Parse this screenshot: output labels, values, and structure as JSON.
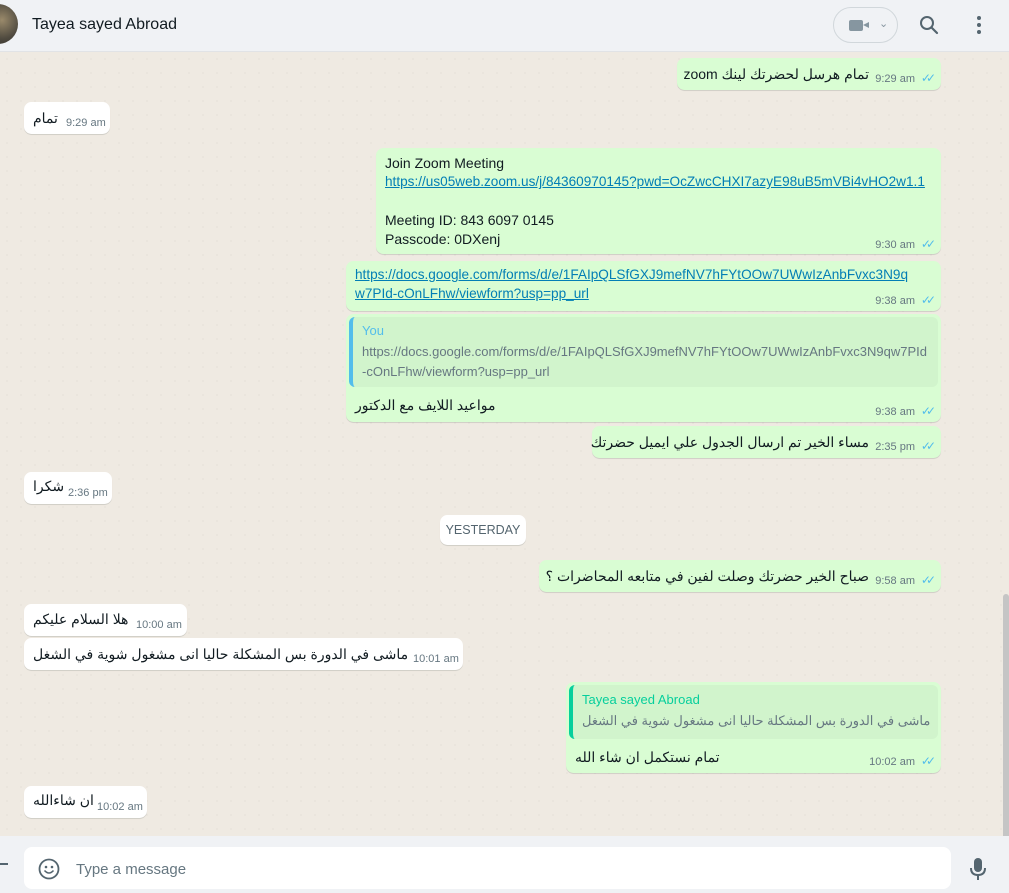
{
  "header": {
    "contact_name": "Tayea sayed Abroad"
  },
  "input": {
    "placeholder": "Type a message"
  },
  "colors": {
    "outgoing": "#d9fdd3",
    "incoming": "#ffffff",
    "read_ticks": "#53bdeb",
    "link": "#027eb5"
  },
  "icons": [
    "avatar",
    "video-call-icon",
    "chevron-down-icon",
    "search-icon",
    "menu-icon",
    "emoji-icon",
    "mic-icon",
    "double-check-icon"
  ],
  "divider": {
    "label": "YESTERDAY"
  },
  "messages": [
    {
      "dir": "out",
      "text": "تمام هرسل لحضرتك لينك zoom",
      "time": "9:29 am"
    },
    {
      "dir": "in",
      "text": "تمام",
      "time": "9:29 am"
    },
    {
      "dir": "out",
      "title": "Join Zoom Meeting",
      "link": "https://us05web.zoom.us/j/84360970145?pwd=OcZwcCHXI7azyE98uB5mVBi4vHO2w1.1",
      "meeting_id": "Meeting ID: 843 6097 0145",
      "passcode": "Passcode: 0DXenj",
      "time": "9:30 am"
    },
    {
      "dir": "out",
      "link_l1": "https://docs.google.com/forms/d/e/1FAIpQLSfGXJ9mefNV7hFYtOOw7UWwIzAnbFvxc3N9q",
      "link_l2": "w7PId-cOnLFhw/viewform?usp=pp_url",
      "time": "9:38 am"
    },
    {
      "dir": "out",
      "quote_author": "You",
      "quote_l1": "https://docs.google.com/forms/d/e/1FAIpQLSfGXJ9mefNV7hFYtOOw7UWwIzAnbFvxc3N9qw7PId",
      "quote_l2": "-cOnLFhw/viewform?usp=pp_url",
      "text": "مواعيد اللايف مع الدكتور",
      "time": "9:38 am"
    },
    {
      "dir": "out",
      "text": "مساء الخير تم ارسال الجدول علي ايميل حضرتك",
      "time": "2:35 pm"
    },
    {
      "dir": "in",
      "text": "شكرا",
      "time": "2:36 pm"
    },
    {
      "dir": "out",
      "text": "صباح الخير حضرتك وصلت لفين في متابعه المحاضرات ؟",
      "time": "9:58 am"
    },
    {
      "dir": "in",
      "text": "هلا السلام عليكم",
      "time": "10:00 am"
    },
    {
      "dir": "in",
      "text": "ماشى في الدورة بس المشكلة حاليا انى مشغول شوية في الشغل",
      "time": "10:01 am"
    },
    {
      "dir": "out",
      "quote_author": "Tayea sayed Abroad",
      "quote_text": "ماشى في الدورة بس المشكلة حاليا انى مشغول شوية في الشغل",
      "text": "تمام نستكمل ان شاء الله",
      "time": "10:02 am"
    },
    {
      "dir": "in",
      "text": "ان شاءالله",
      "time": "10:02 am"
    }
  ]
}
